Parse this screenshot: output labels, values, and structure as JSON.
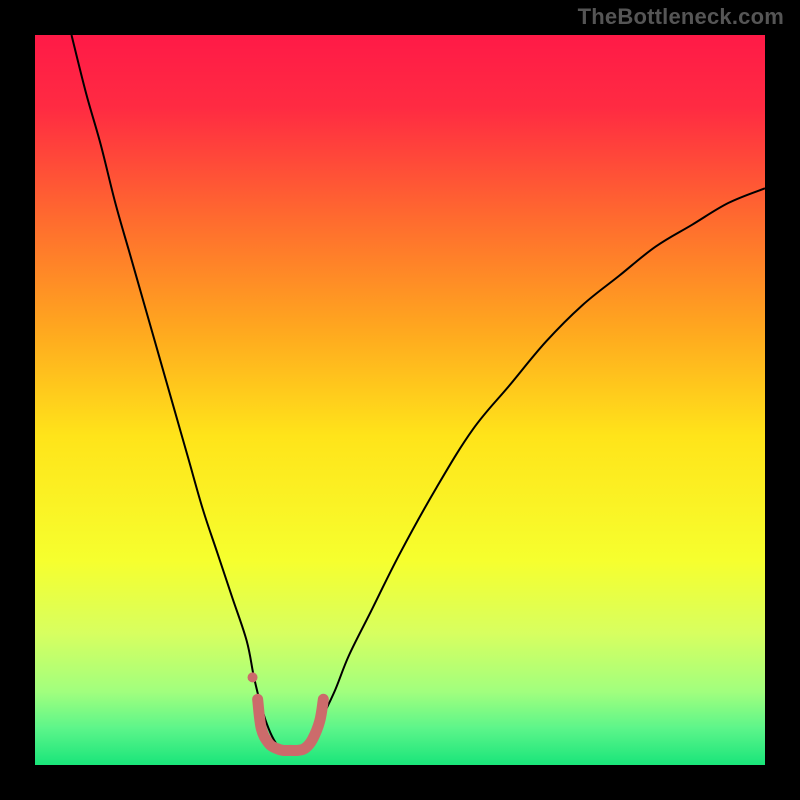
{
  "watermark": "TheBottleneck.com",
  "chart_data": {
    "type": "line",
    "title": "",
    "xlabel": "",
    "ylabel": "",
    "xlim": [
      0,
      100
    ],
    "ylim": [
      0,
      100
    ],
    "background": {
      "type": "vertical_gradient",
      "stops": [
        {
          "offset": 0.0,
          "color": "#ff1a47"
        },
        {
          "offset": 0.1,
          "color": "#ff2b42"
        },
        {
          "offset": 0.25,
          "color": "#ff6a2f"
        },
        {
          "offset": 0.4,
          "color": "#ffa61f"
        },
        {
          "offset": 0.55,
          "color": "#ffe41a"
        },
        {
          "offset": 0.72,
          "color": "#f6ff2e"
        },
        {
          "offset": 0.82,
          "color": "#d7ff60"
        },
        {
          "offset": 0.9,
          "color": "#a1ff7e"
        },
        {
          "offset": 0.95,
          "color": "#5cf58a"
        },
        {
          "offset": 1.0,
          "color": "#19e57a"
        }
      ]
    },
    "series": [
      {
        "name": "curve",
        "stroke": "#000000",
        "stroke_width": 2,
        "x": [
          5,
          7,
          9,
          11,
          13,
          15,
          17,
          19,
          21,
          23,
          25,
          27,
          29,
          30,
          31,
          32,
          33,
          34,
          35,
          36,
          37,
          39,
          41,
          43,
          46,
          50,
          55,
          60,
          65,
          70,
          75,
          80,
          85,
          90,
          95,
          100
        ],
        "y": [
          100,
          92,
          85,
          77,
          70,
          63,
          56,
          49,
          42,
          35,
          29,
          23,
          17,
          12,
          8,
          5,
          3,
          2,
          2,
          2,
          3,
          6,
          10,
          15,
          21,
          29,
          38,
          46,
          52,
          58,
          63,
          67,
          71,
          74,
          77,
          79
        ]
      },
      {
        "name": "bottom-marker",
        "stroke": "#cc6b6b",
        "stroke_width": 11,
        "linecap": "round",
        "x": [
          30.5,
          31,
          32,
          33,
          34,
          35,
          36,
          37,
          38,
          39,
          39.5
        ],
        "y": [
          9,
          5,
          3,
          2.3,
          2,
          2,
          2,
          2.3,
          3.5,
          6,
          9
        ]
      },
      {
        "name": "dot",
        "type": "scatter",
        "fill": "#cc6b6b",
        "r": 5,
        "x": [
          29.8
        ],
        "y": [
          12
        ]
      }
    ]
  }
}
